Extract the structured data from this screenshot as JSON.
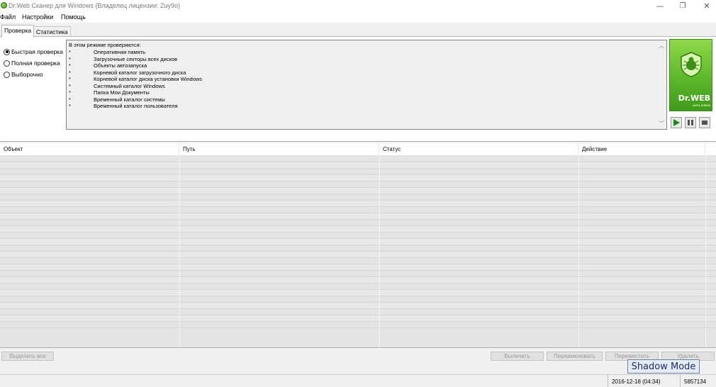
{
  "window": {
    "title": "Dr.Web Сканер для Windows (Владелец лицензии: Zuy9o)",
    "minimize_glyph": "—",
    "maximize_glyph": "❐",
    "close_glyph": "✕"
  },
  "menu": {
    "items": [
      "Файл",
      "Настройки",
      "Помощь"
    ]
  },
  "tabs": [
    {
      "label": "Проверка",
      "active": true
    },
    {
      "label": "Статистика",
      "active": false
    }
  ],
  "scan_modes": [
    {
      "label": "Быстрая проверка",
      "checked": true
    },
    {
      "label": "Полная проверка",
      "checked": false
    },
    {
      "label": "Выборочно",
      "checked": false
    }
  ],
  "description": {
    "header": "В этом режиме проверяются:",
    "bullet": "*",
    "items": [
      "Оперативная память",
      "Загрузочные секторы всех дисков",
      "Объекты автозапуска",
      "Корневой каталог загрузочного диска",
      "Корневой каталог диска установки Windows",
      "Системный каталог Windows",
      "Папка Мои Документы",
      "Временный каталог системы",
      "Временный каталог пользователя"
    ]
  },
  "logo": {
    "text": "Dr.WEB",
    "subtext": "ANTI-VIRUS",
    "brand_color": "#5cb82a"
  },
  "controls": {
    "play_icon": "play-icon",
    "pause_icon": "pause-icon",
    "stop_icon": "stop-icon",
    "play_color": "#1a8a1a"
  },
  "table": {
    "columns": [
      "Объект",
      "Путь",
      "Статус",
      "Действие"
    ],
    "rows": []
  },
  "buttons": {
    "select_all": "Выделить все",
    "cure": "Вылечить",
    "rename": "Переименовать",
    "move": "Переместить",
    "delete": "Удалить"
  },
  "overlay": {
    "shadow_mode": "Shadow Mode"
  },
  "status_bar": {
    "date": "2016-12-18 (04:34)",
    "number": "5857134"
  }
}
